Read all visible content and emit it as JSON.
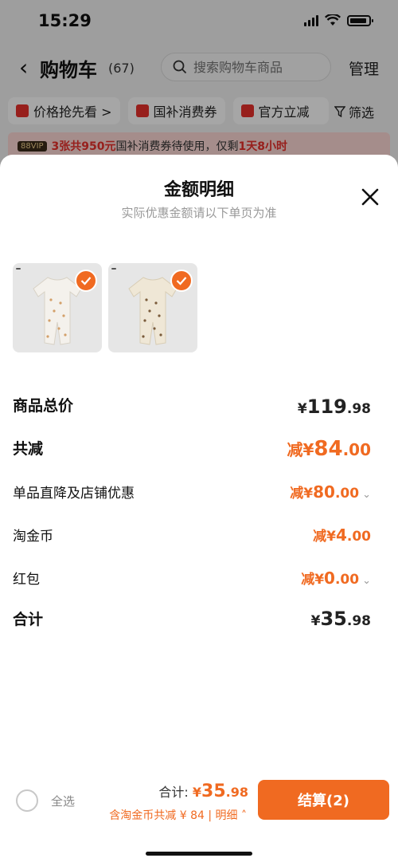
{
  "status_bar": {
    "time": "15:29"
  },
  "header": {
    "back_icon": "chevron-left-icon",
    "title": "购物车",
    "count": "(67)",
    "search_placeholder": "搜索购物车商品",
    "manage": "管理"
  },
  "chips": [
    {
      "label": "价格抢先看 >"
    },
    {
      "label": "国补消费券"
    },
    {
      "label": "官方立减"
    }
  ],
  "filter_label": "筛选",
  "vip_bar": {
    "badge": "88VIP",
    "highlight": "3张共950元",
    "text": "国补消费券待使用，仅剩",
    "time_left": "1天8小时"
  },
  "sheet": {
    "title": "金额明细",
    "subtitle": "实际优惠金额请以下单页为准",
    "rows": [
      {
        "label": "商品总价",
        "prefix": "",
        "currency": "¥",
        "int": "119",
        "dec": ".98"
      },
      {
        "label": "共减",
        "prefix": "减",
        "currency": "¥",
        "int": "84",
        "dec": ".00"
      },
      {
        "label": "单品直降及店铺优惠",
        "prefix": "减",
        "currency": "¥",
        "int": "80",
        "dec": ".00"
      },
      {
        "label": "淘金币",
        "prefix": "减",
        "currency": "¥",
        "int": "4",
        "dec": ".00"
      },
      {
        "label": "红包",
        "prefix": "减",
        "currency": "¥",
        "int": "0",
        "dec": ".00"
      },
      {
        "label": "合计",
        "prefix": "",
        "currency": "¥",
        "int": "35",
        "dec": ".98"
      }
    ]
  },
  "bottom_bar": {
    "select_all": "全选",
    "total_label": "合计:",
    "currency": "¥",
    "total_int": "35",
    "total_dec": ".98",
    "sub_text": "含淘金币共减 ¥ 84 | 明细",
    "checkout": "结算(2)"
  },
  "colors": {
    "accent": "#f06a21",
    "red": "#e8302b"
  }
}
